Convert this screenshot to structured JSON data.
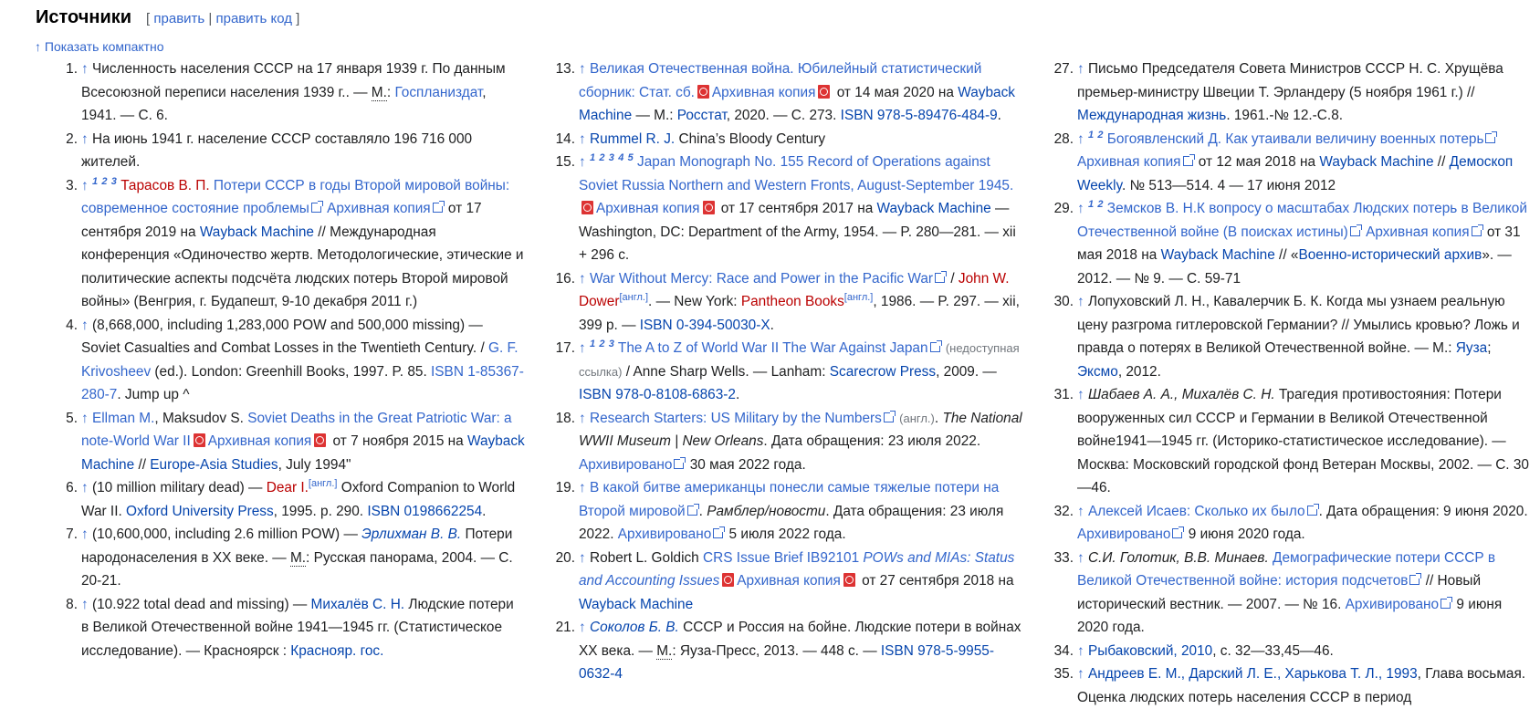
{
  "heading": {
    "title": "Источники",
    "bracket_open": "[",
    "edit": "править",
    "separator": "|",
    "edit_code": "править код",
    "bracket_close": "]"
  },
  "compact_toggle": "↑ Показать компактно",
  "icons": {
    "backlink": "↑",
    "pdf": "pdf-icon",
    "external": "external-link-icon"
  },
  "refs": {
    "r1": {
      "n": "1.",
      "t1": " Численность населения СССР на 17 января 1939 г. По данным Всесоюзной переписи населения 1939 г.. — ",
      "m": "М.",
      "t2": ": ",
      "pub": "Госпланиздат",
      "t3": ", 1941. — С. 6."
    },
    "r2": {
      "n": "2.",
      "t1": " На июнь 1941 г. население СССР составляло 196 716 000 жителей."
    },
    "r3": {
      "n": "3.",
      "s1": "1",
      "s2": "2",
      "s3": "3",
      "author": "Тарасов В. П.",
      "title": "Потери СССР в годы Второй мировой войны: современное состояние проблемы",
      "arch": "Архивная копия",
      "t1": " от 17 сентября 2019 на ",
      "wb": "Wayback Machine",
      "t2": " // Международная конференция «Одиночество жертв. Методологические, этические и политические аспекты подсчёта людских потерь Второй мировой войны» (Венгрия, г. Будапешт, 9-10 декабря 2011 г.)"
    },
    "r4": {
      "n": "4.",
      "t1": " (8,668,000, including 1,283,000 POW and 500,000 missing) — Soviet Casualties and Combat Losses in the Twentieth Century. / ",
      "author": "G. F. Krivosheev",
      "t2": " (ed.). London: Greenhill Books, 1997. P. 85. ",
      "isbn": "ISBN 1-85367-280-7",
      "t3": ". Jump up ^"
    },
    "r5": {
      "n": "5.",
      "a1": "Ellman M.",
      "t1": ", Maksudov S. ",
      "title": "Soviet Deaths in the Great Patriotic War: a note-World War II",
      "arch": "Архивная копия",
      "t2": " от 7 ноября 2015 на ",
      "wb": "Wayback Machine",
      "t3": " // ",
      "jour": "Europe-Asia Studies",
      "t4": ", July 1994\""
    },
    "r6": {
      "n": "6.",
      "t1": " (10 million military dead) — ",
      "author": "Dear I.",
      "lang": "[англ.]",
      "t2": " Oxford Companion to World War II. ",
      "pub": "Oxford University Press",
      "t3": ", 1995. p. 290. ",
      "isbn": "ISBN 0198662254",
      "t4": "."
    },
    "r7": {
      "n": "7.",
      "t1": " (10,600,000, including 2.6 million POW) — ",
      "author": "Эрлихман В. В.",
      "t2": " Потери народонаселения в XX веке. — ",
      "m": "М.",
      "t3": ": Русская панорама, 2004. — С. 20-21."
    },
    "r8": {
      "n": "8.",
      "t1": " (10.922 total dead and missing) — ",
      "author": "Михалёв С. Н.",
      "t2": " Людские потери в Великой Отечественной войне 1941—1945 гг. (Статистическое исследование). — Красноярск : ",
      "pub": "Краснояр. гос."
    },
    "r13": {
      "n": "13.",
      "title": "Великая Отечественная война. Юбилейный статистический сборник: Стат. сб.",
      "arch": "Архивная копия",
      "t1": " от 14 мая 2020 на ",
      "wb": "Wayback Machine",
      "t2": " — М.: ",
      "pub": "Росстат",
      "t3": ", 2020. — С. 273. ",
      "isbn": "ISBN 978-5-89476-484-9",
      "t4": "."
    },
    "r14": {
      "n": "14.",
      "author": "Rummel R. J.",
      "t1": " China’s Bloody Century"
    },
    "r15": {
      "n": "15.",
      "s1": "1",
      "s2": "2",
      "s3": "3",
      "s4": "4",
      "s5": "5",
      "title": "Japan Monograph No. 155 Record of Operations against Soviet Russia Northern and Western Fronts, August-September 1945.",
      "arch": "Архивная копия",
      "t1": " от 17 сентября 2017 на ",
      "wb": "Wayback Machine",
      "t2": " — Washington, DC: Department of the Army, 1954. — P. 280—281. — xii + 296 с."
    },
    "r16": {
      "n": "16.",
      "title": "War Without Mercy: Race and Power in the Pacific War",
      "t1": " / ",
      "author": "John W. Dower",
      "lang1": "[англ.]",
      "t2": ". — New York: ",
      "pub": "Pantheon Books",
      "lang2": "[англ.]",
      "t3": ", 1986. — P. 297. — xii, 399 p. — ",
      "isbn": "ISBN 0-394-50030-X",
      "t4": "."
    },
    "r17": {
      "n": "17.",
      "s1": "1",
      "s2": "2",
      "s3": "3",
      "title": "The A to Z of World War II The War Against Japan",
      "dead": "(недоступная ссылка)",
      "t1": " / Anne Sharp Wells. — Lanham: ",
      "pub": "Scarecrow Press",
      "t2": ", 2009. — ",
      "isbn": "ISBN 978-0-8108-6863-2",
      "t3": "."
    },
    "r18": {
      "n": "18.",
      "title": "Research Starters: US Military by the Numbers",
      "lang": "(англ.)",
      "t1": ". ",
      "it": "The National WWII Museum | New Orleans",
      "t2": ". Дата обращения: 23 июля 2022. ",
      "arch": "Архивировано",
      "t3": " 30 мая 2022 года."
    },
    "r19": {
      "n": "19.",
      "title": "В какой битве американцы понесли самые тяжелые потери на Второй мировой",
      "t1": ". ",
      "it": "Рамблер/новости",
      "t2": ". Дата обращения: 23 июля 2022. ",
      "arch": "Архивировано",
      "t3": " 5 июля 2022 года."
    },
    "r20": {
      "n": "20.",
      "t1": " Robert L. Goldich ",
      "title1": "CRS Issue Brief IB92101 ",
      "title2": "POWs and MIAs: Status and Accounting Issues",
      "arch": "Архивная копия",
      "t2": " от 27 сентября 2018 на ",
      "wb": "Wayback Machine"
    },
    "r21": {
      "n": "21.",
      "author": "Соколов Б. В.",
      "t1": " СССР и Россия на бойне. Людские потери в войнах XX века. — ",
      "m": "М.",
      "t2": ": Яуза-Пресс, 2013. — 448 с. — ",
      "isbn": "ISBN 978-5-9955-0632-4"
    },
    "r27": {
      "n": "27.",
      "t1": " Письмо Председателя Совета Министров СССР Н. С. Хрущёва премьер-министру Швеции Т. Эрландеру (5 ноября 1961 г.) // ",
      "jour": "Международная жизнь",
      "t2": ". 1961.-№ 12.-С.8."
    },
    "r28": {
      "n": "28.",
      "s1": "1",
      "s2": "2",
      "title": "Богоявленский Д. Как утаивали величину военных потерь",
      "arch": "Архивная копия",
      "t1": " от 12 мая 2018 на ",
      "wb": "Wayback Machine",
      "t2": " // ",
      "jour": "Демоскоп Weekly",
      "t3": ". № 513—514. 4 — 17 июня 2012"
    },
    "r29": {
      "n": "29.",
      "s1": "1",
      "s2": "2",
      "title": "Земсков В. Н.К вопросу о масштабах Людских потерь в Великой Отечественной войне (В поисках истины)",
      "arch": "Архивная копия",
      "t1": " от 31 мая 2018 на ",
      "wb": "Wayback Machine",
      "t2": " // «",
      "jour": "Военно-исторический архив",
      "t3": "». — 2012. — № 9. — С. 59-71"
    },
    "r30": {
      "n": "30.",
      "t1": " Лопуховский Л. Н., Кавалерчик Б. К. Когда мы узнаем реальную цену разгрома гитлеровской Германии? // Умылись кровью? Ложь и правда о потерях в Великой Отечественной войне. — М.: ",
      "p1": "Яуза",
      "t2": "; ",
      "p2": "Эксмо",
      "t3": ", 2012."
    },
    "r31": {
      "n": "31.",
      "it": "Шабаев А. А., Михалёв С. Н.",
      "t1": " Трагедия противостояния: Потери вооруженных сил СССР и Германии в Великой Отечественной войне1941—1945 гг. (Историко-статистическое исследование). — Москва: Московский городской фонд Ветеран Москвы, 2002. — С. 30—46."
    },
    "r32": {
      "n": "32.",
      "title": "Алексей Исаев: Сколько их было",
      "t1": ". Дата обращения: 9 июня 2020. ",
      "arch": "Архивировано",
      "t2": " 9 июня 2020 года."
    },
    "r33": {
      "n": "33.",
      "it": "С.И. Голотик, В.В. Минаев.",
      "t1": " ",
      "title": "Демографические потери СССР в Великой Отечественной войне: история подсчетов",
      "t2": " // Новый исторический вестник. — 2007. — № 16. ",
      "arch": "Архивировано",
      "t3": " 9 июня 2020 года."
    },
    "r34": {
      "n": "34.",
      "l1": "Рыбаковский, 2010",
      "t1": ", с. 32—33,45—46."
    },
    "r35": {
      "n": "35.",
      "l1": "Андреев Е. М., Дарский Л. Е., Харькова Т. Л., 1993",
      "t1": ", Глава восьмая. Оценка людских потерь населения СССР в период"
    }
  }
}
